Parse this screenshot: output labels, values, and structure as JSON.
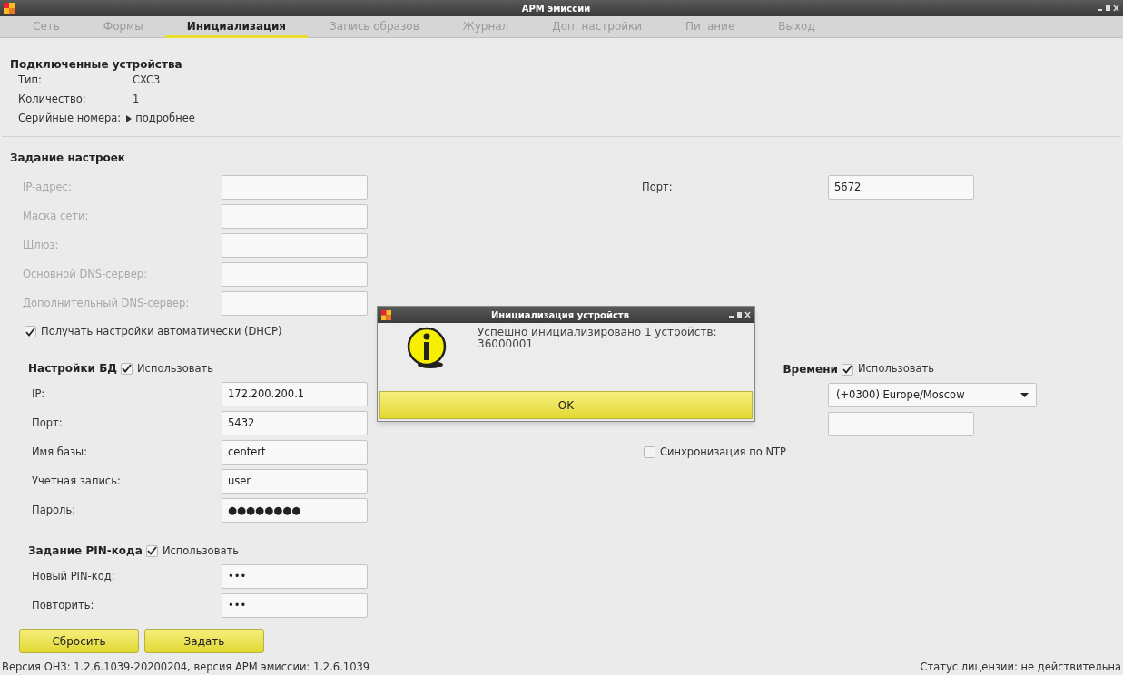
{
  "window": {
    "title": "АРМ эмиссии"
  },
  "tabs": [
    {
      "label": "Сеть",
      "selected": false
    },
    {
      "label": "Формы",
      "selected": false
    },
    {
      "label": "Инициализация",
      "selected": true
    },
    {
      "label": "Запись образов",
      "selected": false
    },
    {
      "label": "Журнал",
      "selected": false
    },
    {
      "label": "Доп. настройки",
      "selected": false
    },
    {
      "label": "Питание",
      "selected": false
    },
    {
      "label": "Выход",
      "selected": false
    }
  ],
  "devices": {
    "title": "Подключенные устройства",
    "rows": [
      {
        "label": "Тип:",
        "value": "CXC3"
      },
      {
        "label": "Количество:",
        "value": "1"
      }
    ],
    "serials": {
      "label": "Серийные номера:",
      "link": "подробнее",
      "expanded": false
    }
  },
  "settings": {
    "title": "Задание настроек",
    "network": {
      "disabled": true,
      "fields": [
        {
          "label": "IP-адрес:"
        },
        {
          "label": "Маска сети:"
        },
        {
          "label": "Шлюз:"
        },
        {
          "label": "Основной DNS-сервер:"
        },
        {
          "label": "Дополнительный DNS-сервер:"
        }
      ],
      "dhcp": {
        "label": "Получать настройки автоматически (DHCP)",
        "checked": true
      }
    },
    "port": {
      "label": "Порт:",
      "value": "5672"
    },
    "db": {
      "title": "Настройки БД",
      "use": {
        "label": "Использовать",
        "checked": true
      },
      "fields": [
        {
          "label": "IP:",
          "value": "172.200.200.1"
        },
        {
          "label": "Порт:",
          "value": "5432"
        },
        {
          "label": "Имя базы:",
          "value": "centert"
        },
        {
          "label": "Учетная запись:",
          "value": "user"
        },
        {
          "label": "Пароль:",
          "value": "●●●●●●●●"
        }
      ]
    },
    "time": {
      "title": "Времени",
      "use": {
        "label": "Использовать",
        "checked": true
      },
      "timezone": "(+0300) Europe/Moscow",
      "ntp_sync": {
        "label": "Синхронизация по NTP",
        "checked": false
      }
    },
    "pin": {
      "title": "Задание PIN-кода",
      "use": {
        "label": "Использовать",
        "checked": true
      },
      "fields": [
        {
          "label": "Новый PIN-код:",
          "value": "•••"
        },
        {
          "label": "Повторить:",
          "value": "•••"
        }
      ]
    },
    "buttons": [
      "Сбросить",
      "Задать"
    ]
  },
  "status_bar": {
    "version": "Версия ОНЗ: 1.2.6.1039-20200204, версия АРМ эмиссии: 1.2.6.1039",
    "license": "Статус лицензии: не действительна"
  },
  "dialog": {
    "title": "Инициализация устройств",
    "message": "Успешно инициализировано 1 устройств:",
    "serial": "36000001",
    "button": "OK"
  }
}
